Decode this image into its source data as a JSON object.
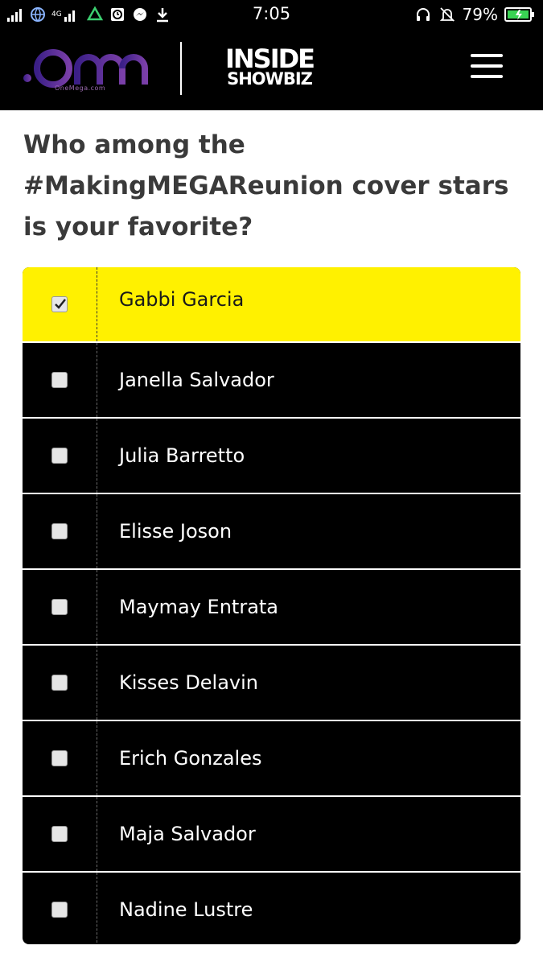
{
  "status_bar": {
    "network": "4G",
    "time": "7:05",
    "battery": "79%"
  },
  "header": {
    "brand_main": ".om",
    "brand_sub": "OneMega.com",
    "section_logo_line1": "INSIDE",
    "section_logo_line2": "SHOWBIZ"
  },
  "question": "Who among the #MakingMEGAReunion cover stars is your favorite?",
  "poll": {
    "options": [
      {
        "label": "Gabbi Garcia",
        "checked": true
      },
      {
        "label": "Janella Salvador",
        "checked": false
      },
      {
        "label": "Julia Barretto",
        "checked": false
      },
      {
        "label": "Elisse Joson",
        "checked": false
      },
      {
        "label": "Maymay Entrata",
        "checked": false
      },
      {
        "label": "Kisses Delavin",
        "checked": false
      },
      {
        "label": "Erich Gonzales",
        "checked": false
      },
      {
        "label": "Maja Salvador",
        "checked": false
      },
      {
        "label": "Nadine Lustre",
        "checked": false
      }
    ]
  },
  "colors": {
    "selected_row": "#fff100",
    "row_bg": "#000000",
    "brand_purple": "#5b2c8f"
  }
}
